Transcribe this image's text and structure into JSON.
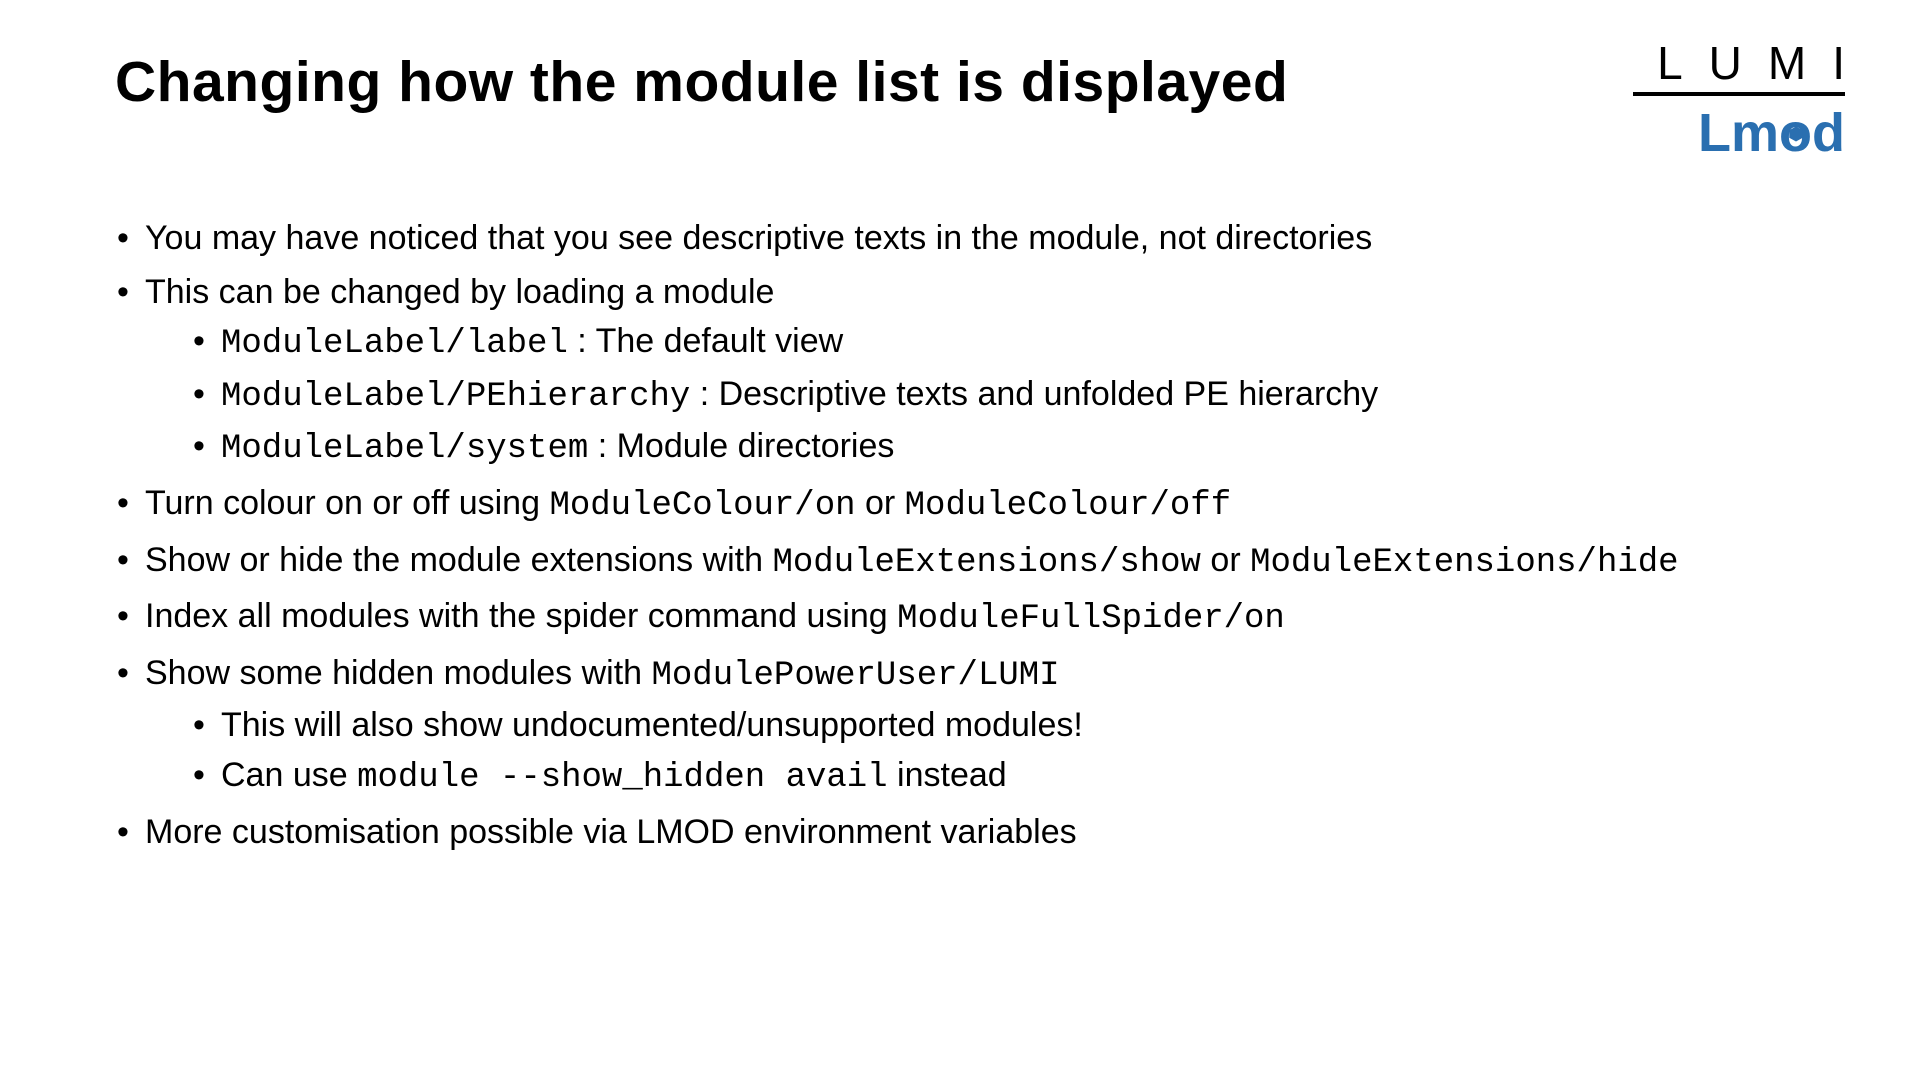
{
  "title": "Changing how the module list is displayed",
  "logo": {
    "lumi": "LUMI",
    "lmod_l": "Lm",
    "lmod_o": "o",
    "lmod_d": "d"
  },
  "bullets": {
    "b1": "You may have noticed that you see descriptive texts in the module, not directories",
    "b2": "This can be changed by loading a module",
    "b2_sub": {
      "s1_code": "ModuleLabel/label",
      "s1_text": " : The default view",
      "s2_code": "ModuleLabel/PEhierarchy",
      "s2_text": " : Descriptive texts and unfolded PE hierarchy",
      "s3_code": "ModuleLabel/system",
      "s3_text": " : Module directories"
    },
    "b3_pre": "Turn colour on or off using ",
    "b3_code1": "ModuleColour/on",
    "b3_mid": " or ",
    "b3_code2": "ModuleColour/off",
    "b4_pre": "Show or hide the module extensions with ",
    "b4_code1": "ModuleExtensions/show",
    "b4_mid": " or ",
    "b4_code2": "ModuleExtensions/hide",
    "b5_pre": "Index all modules with the spider command using ",
    "b5_code": "ModuleFullSpider/on",
    "b6_pre": "Show some hidden modules with ",
    "b6_code": "ModulePowerUser/LUMI",
    "b6_sub": {
      "s1": "This will also show undocumented/unsupported modules!",
      "s2_pre": "Can use ",
      "s2_code": "module --show_hidden avail",
      "s2_post": " instead"
    },
    "b7": "More customisation possible via LMOD environment variables"
  }
}
